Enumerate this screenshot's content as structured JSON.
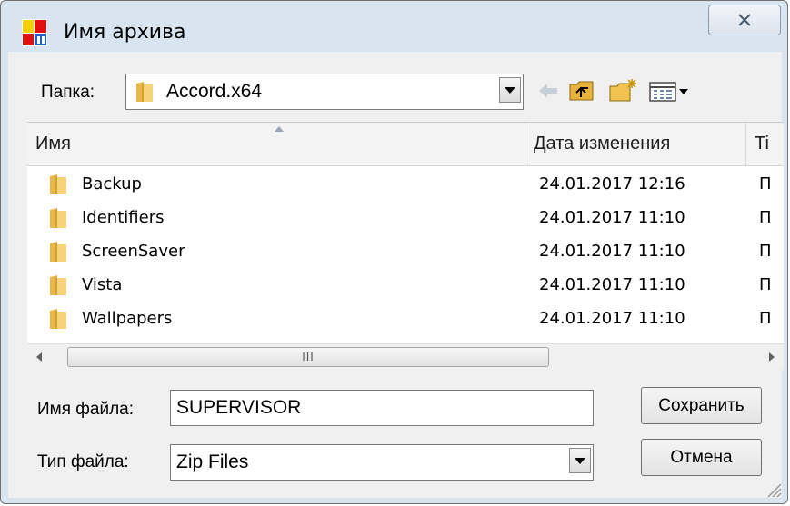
{
  "window": {
    "title": "Имя архива"
  },
  "toolbar": {
    "folder_label": "Папка:",
    "folder_value": "Accord.x64"
  },
  "columns": [
    {
      "label": "Имя"
    },
    {
      "label": "Дата изменения"
    },
    {
      "label": "Ti"
    }
  ],
  "files": [
    {
      "name": "Backup",
      "date": "24.01.2017 12:16",
      "type": "П"
    },
    {
      "name": "Identifiers",
      "date": "24.01.2017 11:10",
      "type": "П"
    },
    {
      "name": "ScreenSaver",
      "date": "24.01.2017 11:10",
      "type": "П"
    },
    {
      "name": "Vista",
      "date": "24.01.2017 11:10",
      "type": "П"
    },
    {
      "name": "Wallpapers",
      "date": "24.01.2017 11:10",
      "type": "П"
    }
  ],
  "filename": {
    "label": "Имя файла:",
    "value": "SUPERVISOR"
  },
  "filetype": {
    "label": "Тип файла:",
    "value": "Zip Files"
  },
  "buttons": {
    "save": "Сохранить",
    "cancel": "Отмена"
  },
  "scroll": {
    "thumb_glyph": "III"
  }
}
